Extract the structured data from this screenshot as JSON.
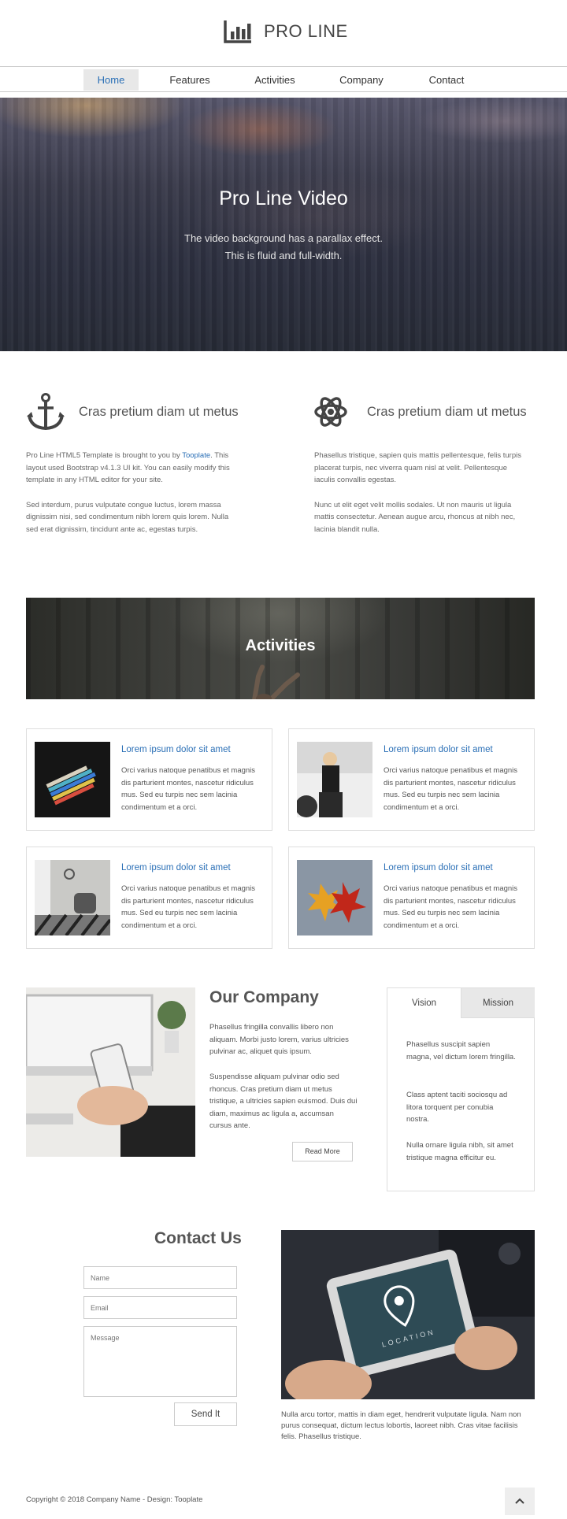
{
  "brand": {
    "name": "PRO LINE",
    "icon": "bar-chart-icon"
  },
  "nav": {
    "items": [
      "Home",
      "Features",
      "Activities",
      "Company",
      "Contact"
    ],
    "active": "Home"
  },
  "hero": {
    "title": "Pro Line Video",
    "line1": "The video background has a parallax effect.",
    "line2": "This is fluid and full-width."
  },
  "features": [
    {
      "icon": "anchor-icon",
      "title": "Cras pretium diam ut metus",
      "p1_before": "Pro Line HTML5 Template is brought to you by ",
      "p1_link": "Tooplate",
      "p1_after": ". This layout used Bootstrap v4.1.3 UI kit. You can easily modify this template in any HTML editor for your site.",
      "p2": "Sed interdum, purus vulputate congue luctus, lorem massa dignissim nisi, sed condimentum nibh lorem quis lorem. Nulla sed erat dignissim, tincidunt ante ac, egestas turpis."
    },
    {
      "icon": "atom-icon",
      "title": "Cras pretium diam ut metus",
      "p1": "Phasellus tristique, sapien quis mattis pellentesque, felis turpis placerat turpis, nec viverra quam nisl at velit. Pellentesque iaculis convallis egestas.",
      "p2": "Nunc ut elit eget velit mollis sodales. Ut non mauris ut ligula mattis consectetur. Aenean augue arcu, rhoncus at nibh nec, lacinia blandit nulla."
    }
  ],
  "activities": {
    "title": "Activities",
    "cards": [
      {
        "title": "Lorem ipsum dolor sit amet",
        "text": "Orci varius natoque penatibus et magnis dis parturient montes, nascetur ridiculus mus. Sed eu turpis nec sem lacinia condimentum et a orci.",
        "image": "paint-swatches"
      },
      {
        "title": "Lorem ipsum dolor sit amet",
        "text": "Orci varius natoque penatibus et magnis dis parturient montes, nascetur ridiculus mus. Sed eu turpis nec sem lacinia condimentum et a orci.",
        "image": "woman-by-car"
      },
      {
        "title": "Lorem ipsum dolor sit amet",
        "text": "Orci varius natoque penatibus et magnis dis parturient montes, nascetur ridiculus mus. Sed eu turpis nec sem lacinia condimentum et a orci.",
        "image": "room-chair"
      },
      {
        "title": "Lorem ipsum dolor sit amet",
        "text": "Orci varius natoque penatibus et magnis dis parturient montes, nascetur ridiculus mus. Sed eu turpis nec sem lacinia condimentum et a orci.",
        "image": "autumn-leaves"
      }
    ]
  },
  "company": {
    "title": "Our Company",
    "p1": "Phasellus fringilla convallis libero non aliquam. Morbi justo lorem, varius ultricies pulvinar ac, aliquet quis ipsum.",
    "p2": "Suspendisse aliquam pulvinar odio sed rhoncus. Cras pretium diam ut metus tristique, a ultricies sapien euismod. Duis dui diam, maximus ac ligula a, accumsan cursus ante.",
    "read_more": "Read More"
  },
  "tabs": {
    "labels": [
      "Vision",
      "Mission"
    ],
    "active": "Vision",
    "paragraphs": [
      "Phasellus suscipit sapien magna, vel dictum lorem fringilla.",
      "Class aptent taciti sociosqu ad litora torquent per conubia nostra.",
      "Nulla ornare ligula nibh, sit amet tristique magna efficitur eu."
    ]
  },
  "contact": {
    "title": "Contact Us",
    "name_placeholder": "Name",
    "email_placeholder": "Email",
    "message_placeholder": "Message",
    "send_label": "Send It",
    "image_text": "LOCATION",
    "caption": "Nulla arcu tortor, mattis in diam eget, hendrerit vulputate ligula. Nam non purus consequat, dictum lectus lobortis, laoreet nibh. Cras vitae facilisis felis. Phasellus tristique."
  },
  "footer": {
    "copyright": "Copyright © 2018 Company Name - Design: Tooplate",
    "to_top_icon": "chevron-up-icon"
  },
  "colors": {
    "accent": "#2a6fb6",
    "text": "#555555",
    "border": "#dddddd"
  }
}
